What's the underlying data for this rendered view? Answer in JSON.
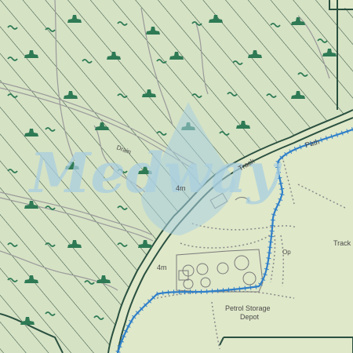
{
  "colors": {
    "land": "#dfe8c9",
    "woodland_hatch": "#2b4a3a",
    "woodland_symbol": "#2e7a55",
    "boundary": "#2f7fc9",
    "road_edge": "#2a5040",
    "track": "#9a9a9a",
    "watermark": "#a9cfe0"
  },
  "icons": {
    "woodland": "coniferous-tree-symbol",
    "scrub": "scrub-tick-symbol"
  },
  "labels": {
    "track_1": "Track",
    "track_2": "Track",
    "path": "Path",
    "spot_height_1": "4m",
    "spot_height_2": "4m",
    "depot_line1": "Petrol Storage",
    "depot_line2": "Depot",
    "drain": "Drain",
    "misc_1": "Op"
  },
  "watermark": "Medway"
}
